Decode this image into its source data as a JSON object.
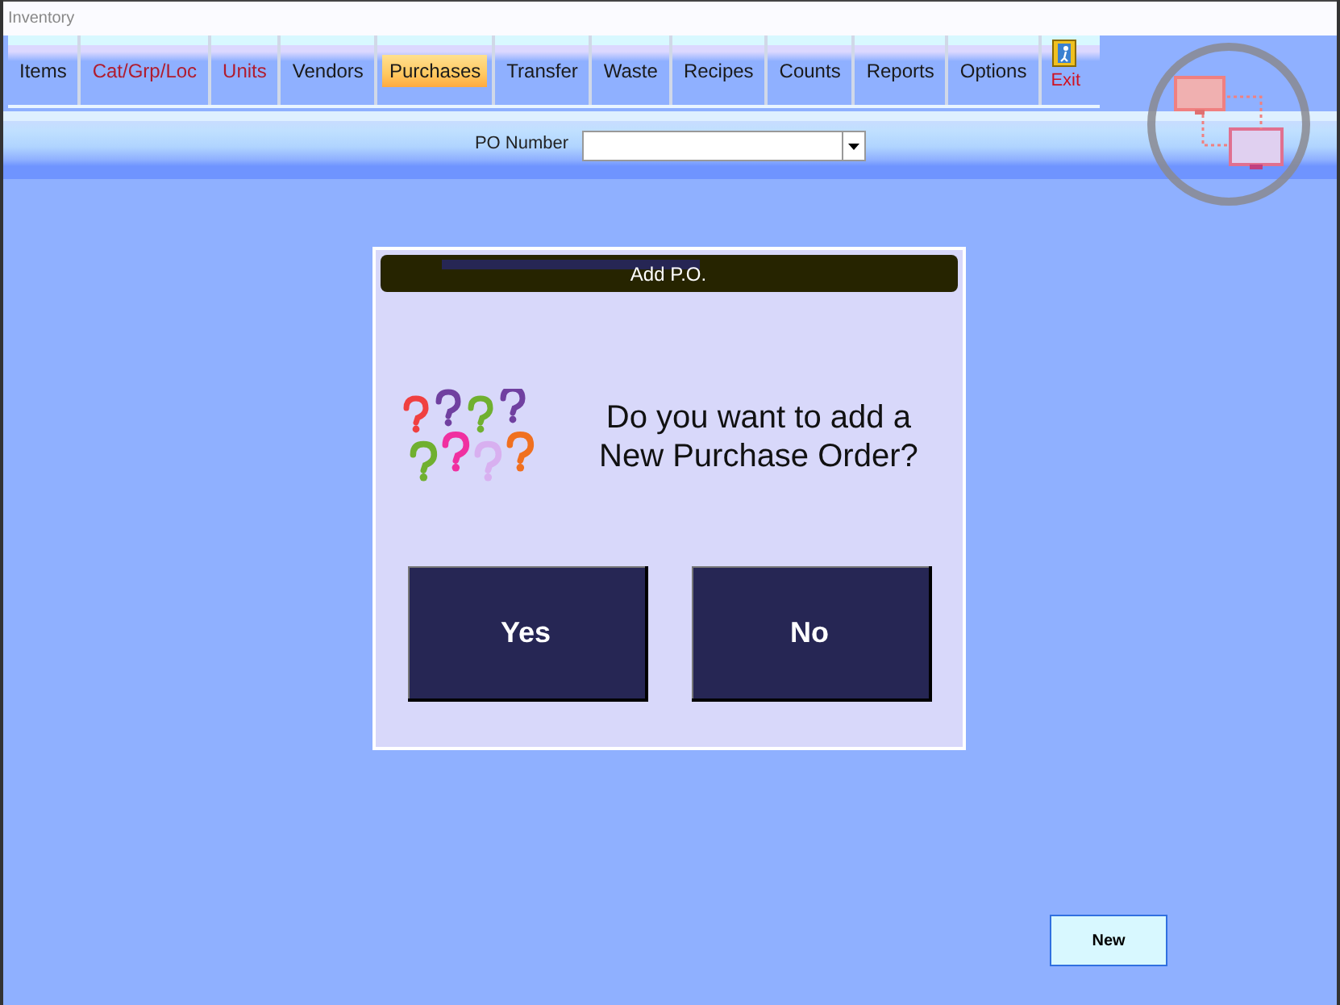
{
  "window": {
    "title": "Inventory"
  },
  "tabs": [
    {
      "label": "Items",
      "selected": false,
      "flagged": false
    },
    {
      "label": "Cat/Grp/Loc",
      "selected": false,
      "flagged": true
    },
    {
      "label": "Units",
      "selected": false,
      "flagged": true
    },
    {
      "label": "Vendors",
      "selected": false,
      "flagged": false
    },
    {
      "label": "Purchases",
      "selected": true,
      "flagged": false
    },
    {
      "label": "Transfer",
      "selected": false,
      "flagged": false
    },
    {
      "label": "Waste",
      "selected": false,
      "flagged": false
    },
    {
      "label": "Recipes",
      "selected": false,
      "flagged": false
    },
    {
      "label": "Counts",
      "selected": false,
      "flagged": false
    },
    {
      "label": "Reports",
      "selected": false,
      "flagged": false
    },
    {
      "label": "Options",
      "selected": false,
      "flagged": false
    }
  ],
  "exit": {
    "label": "Exit"
  },
  "po_number": {
    "label": "PO Number"
  },
  "dialog": {
    "title": "Add P.O.",
    "message_lines": [
      "Do you want to add a",
      "New Purchase Order?"
    ],
    "buttons": [
      "Yes",
      "No"
    ]
  },
  "new_button": "New"
}
